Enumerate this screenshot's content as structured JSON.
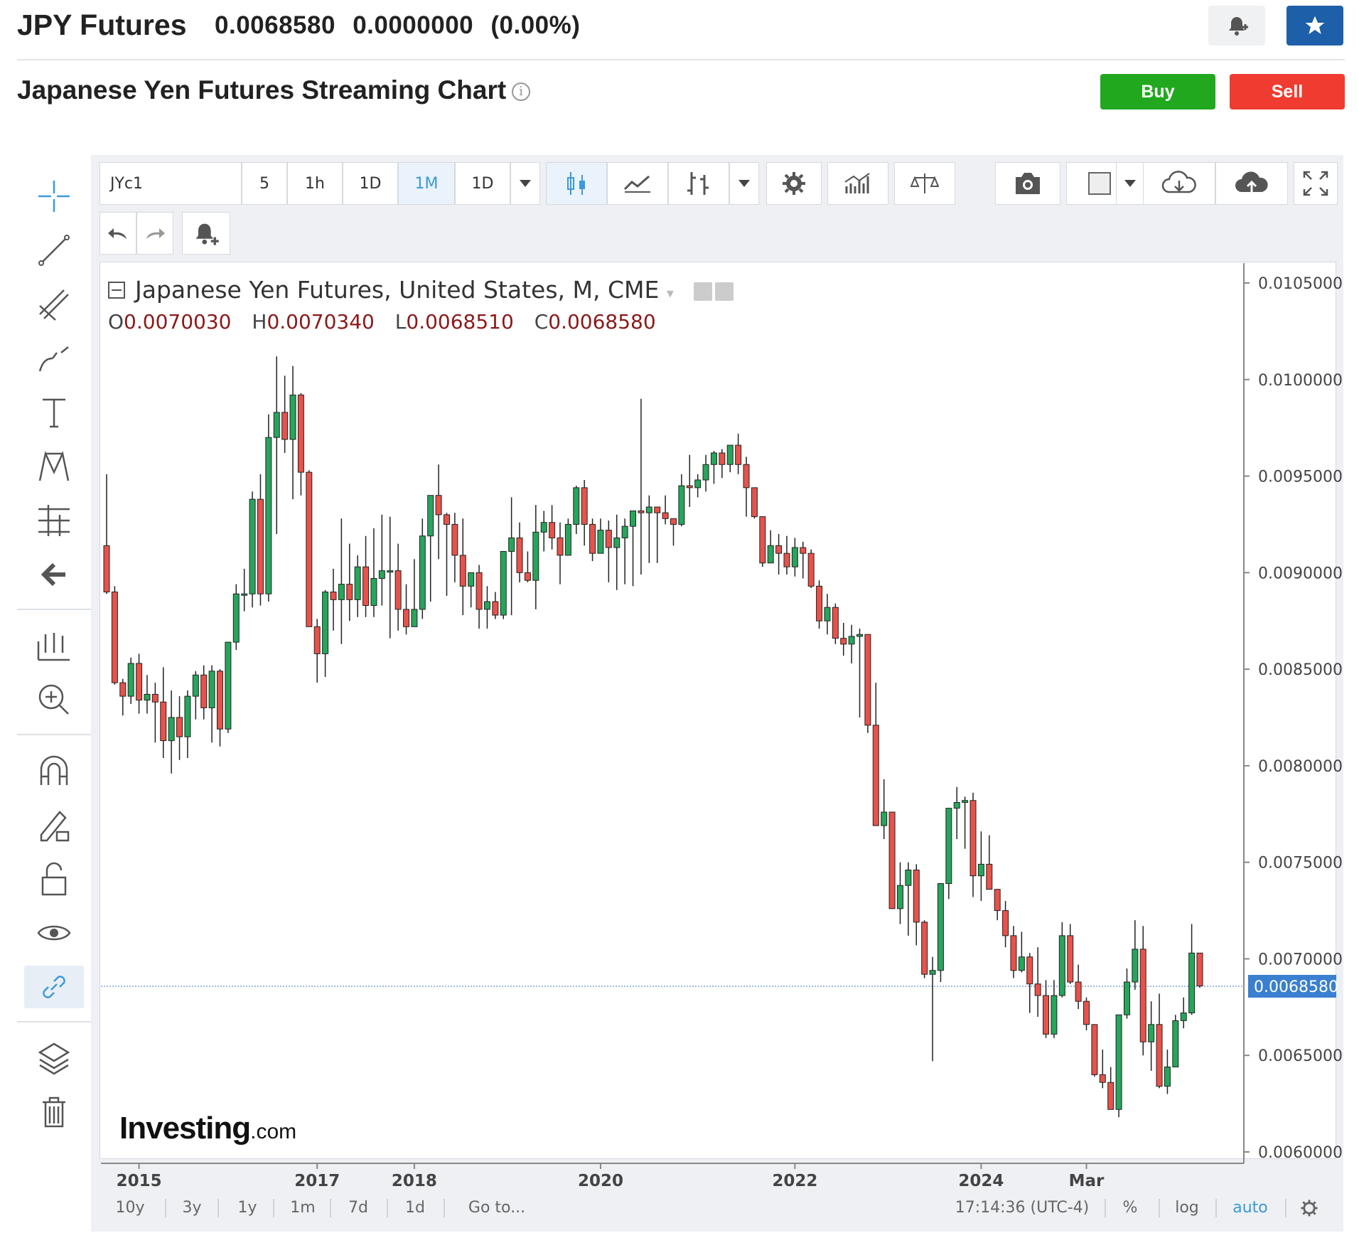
{
  "header": {
    "symbol": "JPY Futures",
    "last": "0.0068580",
    "change": "0.0000000",
    "change_pct": "(0.00%)",
    "subtitle": "Japanese Yen Futures Streaming Chart",
    "buy_label": "Buy",
    "sell_label": "Sell",
    "accent_color": "#1d5fa8",
    "buy_color": "#22a81f",
    "sell_color": "#ef3b30"
  },
  "toolbar": {
    "symbol_input": "JYc1",
    "intervals": [
      "5",
      "1h",
      "1D",
      "1M",
      "1D"
    ],
    "selected_interval": "1M",
    "icons": [
      "candles-icon",
      "line-chart-icon",
      "bars-icon",
      "settings-icon",
      "indicators-icon",
      "compare-icon",
      "camera-icon",
      "color-icon",
      "cloud-download-icon",
      "cloud-upload-icon",
      "fullscreen-icon"
    ]
  },
  "left_tools": [
    "crosshair-icon",
    "trend-line-icon",
    "pitchfork-icon",
    "brush-icon",
    "text-icon",
    "pattern-icon",
    "fib-icon",
    "back-arrow-icon",
    "measure-icon",
    "zoom-in-icon",
    "magnet-icon",
    "lock-drawing-icon",
    "unlock-icon",
    "eye-icon",
    "link-icon",
    "layers-icon",
    "trash-icon"
  ],
  "legend": {
    "title": "Japanese Yen Futures, United States, M, CME",
    "o_label": "O",
    "o": "0.0070030",
    "h_label": "H",
    "h": "0.0070340",
    "l_label": "L",
    "l": "0.0068510",
    "c_label": "C",
    "c": "0.0068580"
  },
  "logo": {
    "main": "Investing",
    "suffix": ".com"
  },
  "bottom": {
    "ranges": [
      "10y",
      "3y",
      "1y",
      "1m",
      "7d",
      "1d"
    ],
    "goto": "Go to...",
    "time": "17:14:36 (UTC-4)",
    "pct": "%",
    "log": "log",
    "auto": "auto"
  },
  "chart_data": {
    "type": "candlestick",
    "title": "Japanese Yen Futures, United States, M, CME",
    "interval": "monthly",
    "ylim": [
      0.006,
      0.0105
    ],
    "y_ticks": [
      "0.0105000",
      "0.0100000",
      "0.0095000",
      "0.0090000",
      "0.0085000",
      "0.0080000",
      "0.0075000",
      "0.0070000",
      "0.0065000",
      "0.0060000"
    ],
    "x_tick_labels": [
      "2015",
      "2017",
      "2018",
      "2020",
      "2022",
      "2024",
      "Mar"
    ],
    "x_tick_index": [
      4,
      26,
      38,
      61,
      85,
      108,
      121
    ],
    "last_price": "0.0068580",
    "up_color": "#26a65b",
    "down_color": "#e8524a",
    "ohlc": [
      [
        0.00914,
        0.00951,
        0.00889,
        0.0089
      ],
      [
        0.0089,
        0.00893,
        0.00842,
        0.00843
      ],
      [
        0.00843,
        0.00845,
        0.00826,
        0.00836
      ],
      [
        0.00836,
        0.00856,
        0.00832,
        0.00853
      ],
      [
        0.00853,
        0.00858,
        0.00827,
        0.00834
      ],
      [
        0.00834,
        0.00847,
        0.00827,
        0.00837
      ],
      [
        0.00837,
        0.00843,
        0.00812,
        0.00833
      ],
      [
        0.00833,
        0.00851,
        0.00804,
        0.00813
      ],
      [
        0.00813,
        0.00839,
        0.00796,
        0.00825
      ],
      [
        0.00825,
        0.00836,
        0.00803,
        0.00815
      ],
      [
        0.00815,
        0.00839,
        0.00804,
        0.00836
      ],
      [
        0.00836,
        0.00849,
        0.00824,
        0.00847
      ],
      [
        0.00847,
        0.00852,
        0.00824,
        0.0083
      ],
      [
        0.0083,
        0.00852,
        0.00812,
        0.00849
      ],
      [
        0.00849,
        0.0085,
        0.0081,
        0.00819
      ],
      [
        0.00819,
        0.00863,
        0.00817,
        0.00864
      ],
      [
        0.00864,
        0.00894,
        0.0086,
        0.00889
      ],
      [
        0.00889,
        0.00902,
        0.0088,
        0.00889
      ],
      [
        0.00889,
        0.00942,
        0.00882,
        0.00938
      ],
      [
        0.00938,
        0.00951,
        0.00883,
        0.00889
      ],
      [
        0.00889,
        0.00982,
        0.00885,
        0.0097
      ],
      [
        0.0097,
        0.01012,
        0.0092,
        0.00983
      ],
      [
        0.00983,
        0.01002,
        0.00962,
        0.00969
      ],
      [
        0.00969,
        0.01007,
        0.00938,
        0.00992
      ],
      [
        0.00992,
        0.00993,
        0.0094,
        0.00952
      ],
      [
        0.00952,
        0.00953,
        0.00885,
        0.00872
      ],
      [
        0.00872,
        0.00876,
        0.00843,
        0.00858
      ],
      [
        0.00858,
        0.00891,
        0.00846,
        0.0089
      ],
      [
        0.0089,
        0.00902,
        0.0087,
        0.00886
      ],
      [
        0.00886,
        0.00928,
        0.00863,
        0.00894
      ],
      [
        0.00894,
        0.00915,
        0.00875,
        0.00886
      ],
      [
        0.00886,
        0.00909,
        0.00877,
        0.00903
      ],
      [
        0.00903,
        0.00919,
        0.00877,
        0.00883
      ],
      [
        0.00883,
        0.00923,
        0.00877,
        0.00897
      ],
      [
        0.00897,
        0.0093,
        0.00883,
        0.00901
      ],
      [
        0.00901,
        0.00929,
        0.00866,
        0.00901
      ],
      [
        0.00901,
        0.00915,
        0.0087,
        0.00881
      ],
      [
        0.00881,
        0.00894,
        0.00868,
        0.00872
      ],
      [
        0.00872,
        0.00907,
        0.00873,
        0.00881
      ],
      [
        0.00881,
        0.00928,
        0.00876,
        0.00919
      ],
      [
        0.00919,
        0.00935,
        0.00885,
        0.0094
      ],
      [
        0.0094,
        0.00956,
        0.00907,
        0.0093
      ],
      [
        0.0093,
        0.00931,
        0.00888,
        0.00925
      ],
      [
        0.00925,
        0.00931,
        0.00895,
        0.00909
      ],
      [
        0.00909,
        0.00928,
        0.00878,
        0.00893
      ],
      [
        0.00893,
        0.00893,
        0.00882,
        0.009
      ],
      [
        0.009,
        0.00904,
        0.00871,
        0.00881
      ],
      [
        0.00881,
        0.00893,
        0.00871,
        0.00885
      ],
      [
        0.00885,
        0.0089,
        0.00876,
        0.00878
      ],
      [
        0.00878,
        0.00906,
        0.00876,
        0.00911
      ],
      [
        0.00911,
        0.00939,
        0.00878,
        0.00918
      ],
      [
        0.00918,
        0.00926,
        0.00895,
        0.009
      ],
      [
        0.009,
        0.00911,
        0.00895,
        0.00896
      ],
      [
        0.00896,
        0.00935,
        0.00881,
        0.00921
      ],
      [
        0.00921,
        0.00932,
        0.00911,
        0.00926
      ],
      [
        0.00926,
        0.00935,
        0.00912,
        0.00918
      ],
      [
        0.00918,
        0.00926,
        0.00894,
        0.00909
      ],
      [
        0.00909,
        0.00928,
        0.00913,
        0.00925
      ],
      [
        0.00925,
        0.00945,
        0.0092,
        0.00944
      ],
      [
        0.00944,
        0.00948,
        0.00914,
        0.00925
      ],
      [
        0.00925,
        0.00928,
        0.00906,
        0.0091
      ],
      [
        0.0091,
        0.00928,
        0.0091,
        0.00922
      ],
      [
        0.00922,
        0.00927,
        0.00895,
        0.00913
      ],
      [
        0.00913,
        0.0093,
        0.00891,
        0.00918
      ],
      [
        0.00918,
        0.00928,
        0.00894,
        0.00924
      ],
      [
        0.00924,
        0.0093,
        0.00893,
        0.00932
      ],
      [
        0.00932,
        0.0099,
        0.00899,
        0.00931
      ],
      [
        0.00931,
        0.0094,
        0.00905,
        0.00934
      ],
      [
        0.00934,
        0.00934,
        0.00905,
        0.00931
      ],
      [
        0.00931,
        0.0094,
        0.00925,
        0.00928
      ],
      [
        0.00928,
        0.00927,
        0.00914,
        0.00925
      ],
      [
        0.00925,
        0.00951,
        0.00924,
        0.00945
      ],
      [
        0.00945,
        0.00961,
        0.00934,
        0.00944
      ],
      [
        0.00944,
        0.00951,
        0.00939,
        0.00948
      ],
      [
        0.00948,
        0.00961,
        0.00942,
        0.00956
      ],
      [
        0.00956,
        0.00963,
        0.00946,
        0.00962
      ],
      [
        0.00962,
        0.00964,
        0.00949,
        0.00956
      ],
      [
        0.00956,
        0.00966,
        0.00952,
        0.00966
      ],
      [
        0.00966,
        0.00972,
        0.00951,
        0.00956
      ],
      [
        0.00956,
        0.0096,
        0.00929,
        0.00944
      ],
      [
        0.00944,
        0.00931,
        0.00928,
        0.00929
      ],
      [
        0.00929,
        0.00928,
        0.00903,
        0.00905
      ],
      [
        0.00905,
        0.00922,
        0.00905,
        0.00914
      ],
      [
        0.00914,
        0.0092,
        0.00899,
        0.0091
      ],
      [
        0.0091,
        0.00919,
        0.00899,
        0.00903
      ],
      [
        0.00903,
        0.00918,
        0.00898,
        0.00913
      ],
      [
        0.00913,
        0.00916,
        0.00897,
        0.0091
      ],
      [
        0.0091,
        0.00912,
        0.00892,
        0.00893
      ],
      [
        0.00893,
        0.00896,
        0.00871,
        0.00875
      ],
      [
        0.00875,
        0.00889,
        0.00868,
        0.00882
      ],
      [
        0.00882,
        0.00884,
        0.00863,
        0.00866
      ],
      [
        0.00866,
        0.00874,
        0.00857,
        0.00863
      ],
      [
        0.00863,
        0.00873,
        0.00853,
        0.00867
      ],
      [
        0.00867,
        0.00871,
        0.00825,
        0.00868
      ],
      [
        0.00868,
        0.00865,
        0.00817,
        0.00821
      ],
      [
        0.00821,
        0.00843,
        0.00798,
        0.00769
      ],
      [
        0.00769,
        0.00793,
        0.00762,
        0.00776
      ],
      [
        0.00776,
        0.00776,
        0.00734,
        0.00726
      ],
      [
        0.00726,
        0.0075,
        0.00718,
        0.00738
      ],
      [
        0.00738,
        0.0075,
        0.00712,
        0.00746
      ],
      [
        0.00746,
        0.00749,
        0.00707,
        0.00719
      ],
      [
        0.00719,
        0.0072,
        0.0069,
        0.00692
      ],
      [
        0.00692,
        0.00701,
        0.00647,
        0.00694
      ],
      [
        0.00694,
        0.00732,
        0.00688,
        0.00739
      ],
      [
        0.00739,
        0.00764,
        0.00731,
        0.00778
      ],
      [
        0.00778,
        0.00789,
        0.00762,
        0.00781
      ],
      [
        0.00781,
        0.00784,
        0.00757,
        0.00782
      ],
      [
        0.00782,
        0.00786,
        0.00732,
        0.00743
      ],
      [
        0.00743,
        0.00766,
        0.0073,
        0.00749
      ],
      [
        0.00749,
        0.00764,
        0.00738,
        0.00736
      ],
      [
        0.00736,
        0.00733,
        0.0072,
        0.00725
      ],
      [
        0.00725,
        0.0073,
        0.00706,
        0.00712
      ],
      [
        0.00712,
        0.00717,
        0.0069,
        0.00694
      ],
      [
        0.00694,
        0.00714,
        0.00693,
        0.00701
      ],
      [
        0.00701,
        0.00703,
        0.00672,
        0.00687
      ],
      [
        0.00687,
        0.00706,
        0.0067,
        0.00681
      ],
      [
        0.00681,
        0.00689,
        0.00659,
        0.00661
      ],
      [
        0.00661,
        0.00689,
        0.00659,
        0.00681
      ],
      [
        0.00681,
        0.00719,
        0.0068,
        0.00712
      ],
      [
        0.00712,
        0.00718,
        0.00687,
        0.00688
      ],
      [
        0.00688,
        0.00697,
        0.00674,
        0.00678
      ],
      [
        0.00678,
        0.0068,
        0.00663,
        0.00666
      ],
      [
        0.00666,
        0.00664,
        0.00639,
        0.0064
      ],
      [
        0.0064,
        0.00653,
        0.00633,
        0.00636
      ],
      [
        0.00636,
        0.00644,
        0.00625,
        0.00622
      ],
      [
        0.00622,
        0.00669,
        0.00618,
        0.00671
      ],
      [
        0.00671,
        0.00695,
        0.00669,
        0.00688
      ],
      [
        0.00688,
        0.0072,
        0.00684,
        0.00705
      ],
      [
        0.00705,
        0.00717,
        0.0065,
        0.00657
      ],
      [
        0.00657,
        0.00678,
        0.00642,
        0.00666
      ],
      [
        0.00666,
        0.00682,
        0.00633,
        0.00634
      ],
      [
        0.00634,
        0.00653,
        0.0063,
        0.00644
      ],
      [
        0.00644,
        0.00671,
        0.00644,
        0.00668
      ],
      [
        0.00668,
        0.0068,
        0.00664,
        0.00672
      ],
      [
        0.00672,
        0.00718,
        0.00671,
        0.00703
      ],
      [
        0.00703,
        0.00703,
        0.00685,
        0.00686
      ]
    ]
  }
}
